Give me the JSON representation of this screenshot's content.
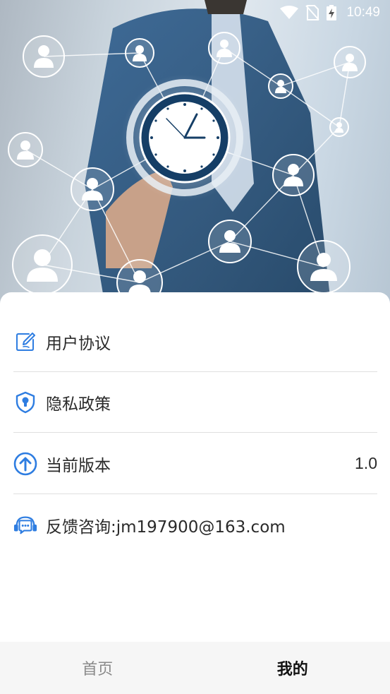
{
  "status_bar": {
    "time": "10:49"
  },
  "hero": {
    "image": "business-network-clock-illustration"
  },
  "menu": {
    "items": [
      {
        "label": "用户协议",
        "icon": "edit-document-icon"
      },
      {
        "label": "隐私政策",
        "icon": "shield-lock-icon"
      },
      {
        "label": "当前版本",
        "icon": "arrow-up-circle-icon",
        "value": "1.0"
      },
      {
        "label": "反馈咨询:jm197900@163.com",
        "icon": "headset-chat-icon"
      }
    ]
  },
  "tabs": [
    {
      "label": "首页",
      "active": false
    },
    {
      "label": "我的",
      "active": true
    }
  ],
  "colors": {
    "accent": "#2e7de1",
    "tab_bar_bg": "#f6f6f6",
    "divider": "#e0e0e0"
  }
}
